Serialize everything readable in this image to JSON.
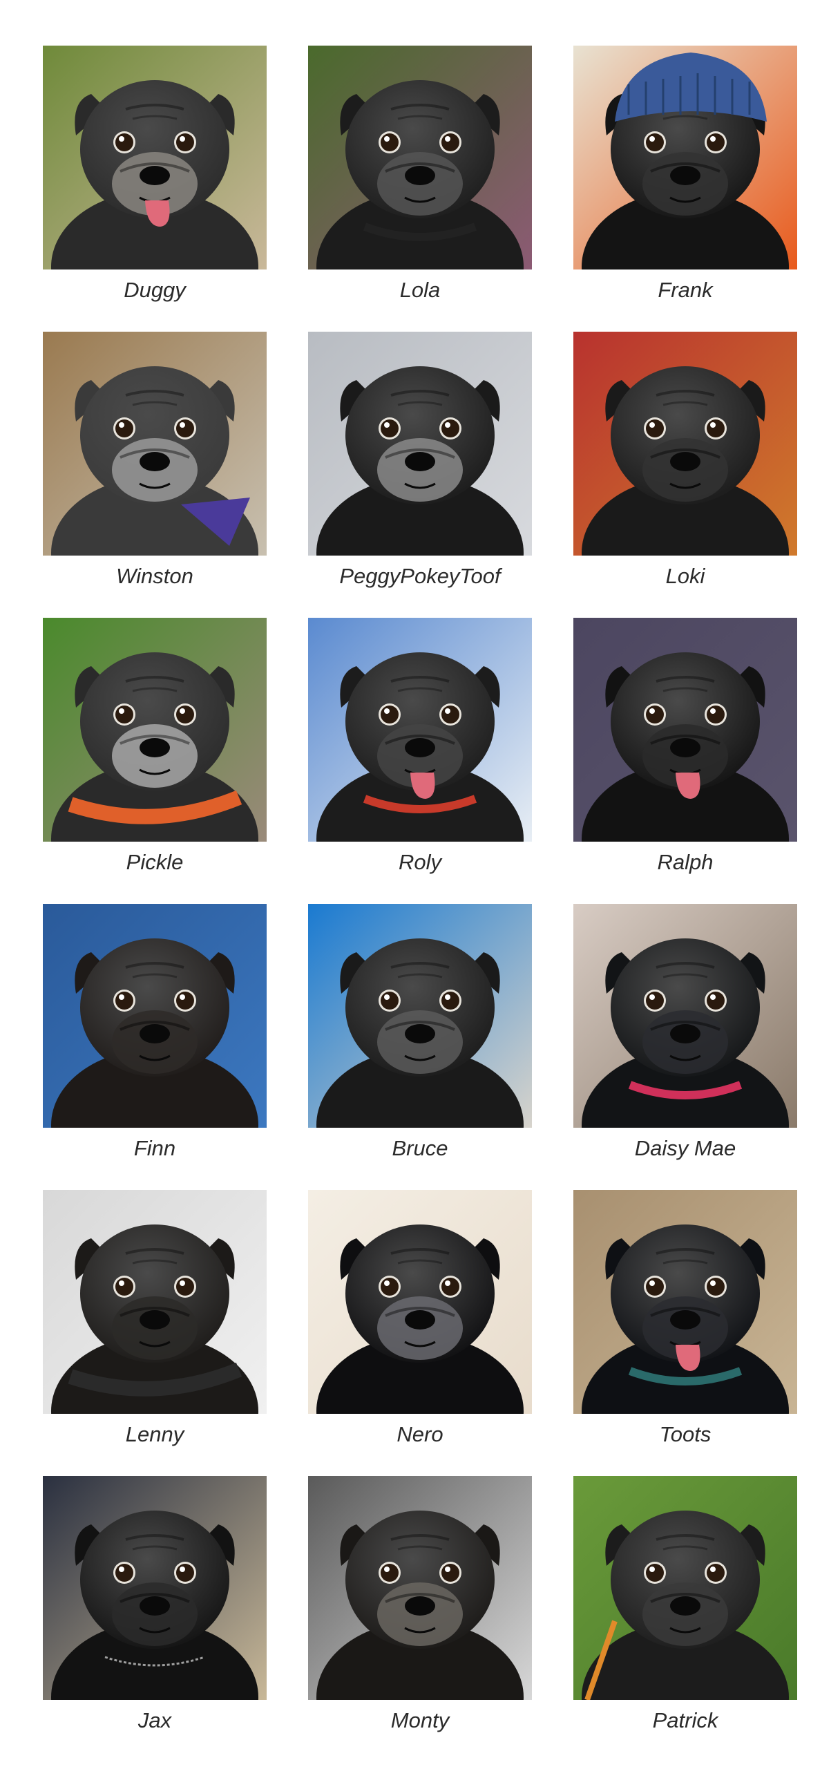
{
  "gallery": {
    "pugs": [
      {
        "name": "Duggy",
        "bg": "#6f8a3a",
        "bg2": "#c9b89a",
        "eyes": "open",
        "tongue": true,
        "accessory": "none",
        "fur": "#2a2a2a",
        "muzzle": "#8a8680"
      },
      {
        "name": "Lola",
        "bg": "#4a6a2c",
        "bg2": "#8c5a74",
        "eyes": "open",
        "tongue": false,
        "accessory": "collar",
        "accessory_color": "#222222",
        "fur": "#1c1c1c",
        "muzzle": "#555555"
      },
      {
        "name": "Frank",
        "bg": "#e8e2d2",
        "bg2": "#e85a1c",
        "eyes": "open",
        "tongue": false,
        "accessory": "beanie",
        "accessory_color": "#3a5a9a",
        "fur": "#141414",
        "muzzle": "#333333"
      },
      {
        "name": "Winston",
        "bg": "#9a7a50",
        "bg2": "#c8c0b0",
        "eyes": "open",
        "tongue": false,
        "accessory": "bandana",
        "accessory_color": "#4a3a9a",
        "fur": "#3a3a3a",
        "muzzle": "#9a9a9a"
      },
      {
        "name": "PeggyPokeyToof",
        "bg": "#b8bcc2",
        "bg2": "#d8dade",
        "eyes": "open",
        "tongue": false,
        "accessory": "none",
        "fur": "#1a1a1a",
        "muzzle": "#8a8a8a"
      },
      {
        "name": "Loki",
        "bg": "#b8322e",
        "bg2": "#d07a2c",
        "eyes": "open",
        "tongue": false,
        "accessory": "none",
        "fur": "#1a1a1a",
        "muzzle": "#333333"
      },
      {
        "name": "Pickle",
        "bg": "#4a8a2c",
        "bg2": "#9a8a7a",
        "eyes": "open",
        "tongue": false,
        "accessory": "harness",
        "accessory_color": "#e0602a",
        "fur": "#2a2a2a",
        "muzzle": "#a8a8a8"
      },
      {
        "name": "Roly",
        "bg": "#5a8ad0",
        "bg2": "#e8eef4",
        "eyes": "open",
        "tongue": true,
        "accessory": "collar",
        "accessory_color": "#c83a2a",
        "fur": "#1c1c1c",
        "muzzle": "#444444"
      },
      {
        "name": "Ralph",
        "bg": "#4c4660",
        "bg2": "#5a546c",
        "eyes": "open",
        "tongue": true,
        "accessory": "none",
        "fur": "#121212",
        "muzzle": "#2a2a2a"
      },
      {
        "name": "Finn",
        "bg": "#2a5a9a",
        "bg2": "#3c78c0",
        "eyes": "open",
        "tongue": false,
        "accessory": "none",
        "fur": "#1e1a18",
        "muzzle": "#2e2a28"
      },
      {
        "name": "Bruce",
        "bg": "#1a7ad0",
        "bg2": "#d8d4cc",
        "eyes": "open",
        "tongue": false,
        "accessory": "none",
        "fur": "#1a1a1a",
        "muzzle": "#5a5a5a"
      },
      {
        "name": "Daisy Mae",
        "bg": "#d8ccc4",
        "bg2": "#8a7a6a",
        "eyes": "open",
        "tongue": false,
        "accessory": "collar",
        "accessory_color": "#d0305a",
        "fur": "#121416",
        "muzzle": "#2a2c30"
      },
      {
        "name": "Lenny",
        "bg": "#d8d8d8",
        "bg2": "#f0f0f0",
        "eyes": "open",
        "tongue": false,
        "accessory": "harness",
        "accessory_color": "#2a2a2a",
        "fur": "#1c1a18",
        "muzzle": "#2c2a28"
      },
      {
        "name": "Nero",
        "bg": "#f4eee4",
        "bg2": "#e8dccc",
        "eyes": "open",
        "tongue": false,
        "accessory": "none",
        "fur": "#0e0e10",
        "muzzle": "#6a6a70"
      },
      {
        "name": "Toots",
        "bg": "#a89070",
        "bg2": "#c8b494",
        "eyes": "open",
        "tongue": true,
        "accessory": "collar",
        "accessory_color": "#2a6a6a",
        "fur": "#0e1014",
        "muzzle": "#2a2c30"
      },
      {
        "name": "Jax",
        "bg": "#2a3040",
        "bg2": "#c8b898",
        "eyes": "open",
        "tongue": false,
        "accessory": "chain",
        "accessory_color": "#a0a0a0",
        "fur": "#121212",
        "muzzle": "#2a2a2a"
      },
      {
        "name": "Monty",
        "bg": "#5a5a5a",
        "bg2": "#d8d8d8",
        "eyes": "open",
        "tongue": false,
        "accessory": "none",
        "fur": "#1a1816",
        "muzzle": "#6a6660"
      },
      {
        "name": "Patrick",
        "bg": "#6a9a3a",
        "bg2": "#4a7a2a",
        "eyes": "open",
        "tongue": false,
        "accessory": "lead",
        "accessory_color": "#e08a2a",
        "fur": "#1c1c1c",
        "muzzle": "#3a3a3a"
      }
    ]
  }
}
